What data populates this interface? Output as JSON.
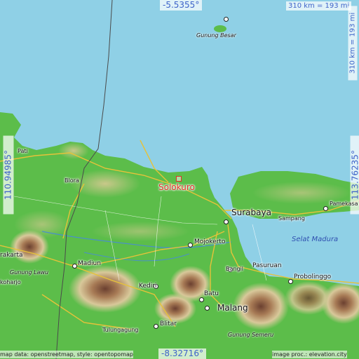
{
  "map": {
    "coords": {
      "top": "-5.5355°",
      "bottom": "-8.32716°",
      "left": "110.94985°",
      "right": "113.76235°"
    },
    "scale": {
      "horizontal": "310 km = 193 mi",
      "vertical": "310 km = 193 mi"
    },
    "focus_place": "Solokuro",
    "cities": {
      "surabaya": "Surabaya",
      "mojokerto": "Mojokerto",
      "madiun": "Madiun",
      "kediri": "Kediri",
      "batu": "Batu",
      "malang": "Malang",
      "blitar": "Blitar",
      "pasuruan": "Pasuruan",
      "probolinggo": "Probolinggo",
      "bangil": "Bangil",
      "sampang": "Sampang",
      "pamekasan": "Pamekasa",
      "blora": "Blora",
      "pati": "Pati",
      "surakarta": "rakarta",
      "sukoharjo": "koharjo",
      "tulungagung": "Tulungagung"
    },
    "features": {
      "gunung_besar": "Gunung Besar",
      "gunung_lawu": "Gunung Lawu",
      "gunung_semeru": "Gunung Semeru",
      "selat_madura": "Selat Madura"
    },
    "attribution": {
      "left": "map data: openstreetmap, style: opentopomap",
      "right": "image proc.: elevation.city"
    },
    "colors": {
      "sea": "#8fd0e6",
      "lowland": "#5cbd4a",
      "hills": "#b8c86a",
      "mountain": "#8a5a3c",
      "accent": "#e0302a",
      "label_blue": "#3e63c9"
    }
  }
}
